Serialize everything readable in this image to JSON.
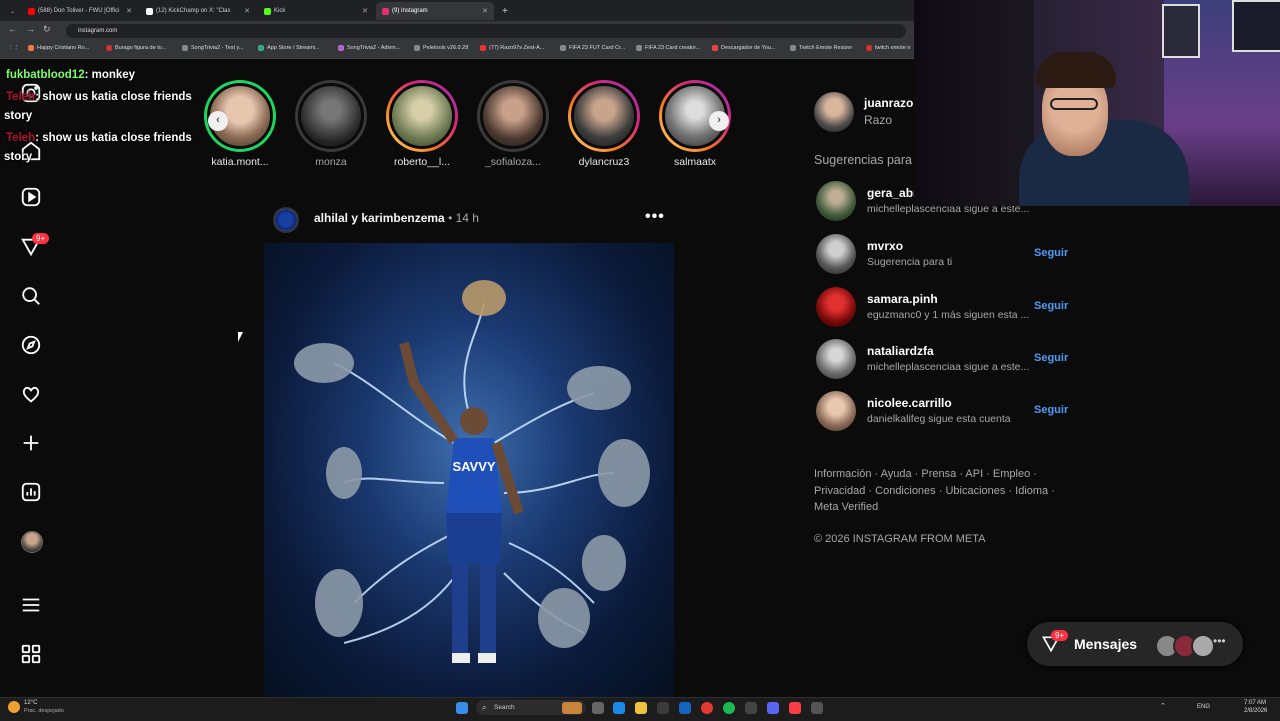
{
  "browser": {
    "tabs": [
      {
        "label": "(588) Don Toliver - FWU [Offici",
        "color": "#ff0000"
      },
      {
        "label": "(12) KickChamp on X: \"Clas",
        "color": "#ffffff"
      },
      {
        "label": "Kick",
        "color": "#53fc18"
      },
      {
        "label": "(9) Instagram",
        "color": "#e1306c"
      }
    ],
    "url": "instagram.com",
    "bookmarks": [
      "Happy Cristiano Ro...",
      "Burago figura de to...",
      "SongTrivia2 - Test y...",
      "App Store / Streami...",
      "SongTrivia2 - Adivin...",
      "Peletools v26.0.28",
      "(77) Razo97s Zest-A...",
      "FIFA 23 FUT Card Cr...",
      "FIFA 23 Card creator...",
      "Descargador de You...",
      "Twitch Emote Resizer",
      "twitch emote n"
    ]
  },
  "chat_overlay": {
    "line1_user": "fukbatblood12",
    "line1_msg": ": monkey",
    "line2_user": "Teleh",
    "line2_msg": ": show us katia close friends",
    "line2_cont": "story",
    "line3_user": "Teleh",
    "line3_msg": ": show us katia close friends",
    "line3_cont": "story"
  },
  "nav": {
    "notif_badge": "9+",
    "icons": [
      "instagram-icon",
      "home-icon",
      "reels-icon",
      "messages-icon",
      "search-icon",
      "explore-icon",
      "heart-icon",
      "create-icon",
      "dashboard-icon",
      "profile-icon",
      "menu-icon",
      "more-icon"
    ]
  },
  "stories": [
    {
      "name": "katia.mont...",
      "ring": "close-friends"
    },
    {
      "name": "monza",
      "ring": "seen"
    },
    {
      "name": "roberto__l...",
      "ring": "new"
    },
    {
      "name": "_sofialoza...",
      "ring": "seen"
    },
    {
      "name": "dylancruz3",
      "ring": "new"
    },
    {
      "name": "salmaatx",
      "ring": "new"
    }
  ],
  "post": {
    "author": "alhilal y karimbenzema",
    "sep": "•",
    "time": "14 h",
    "jersey_text": "SAVVY"
  },
  "profile": {
    "username": "juanrazo",
    "fullname": "Razo"
  },
  "suggestions": {
    "heading": "Sugerencias para ti",
    "follow_label": "Seguir",
    "items": [
      {
        "name": "gera_abr",
        "sub": "michelleplascenciaa sigue a este..."
      },
      {
        "name": "mvrxo",
        "sub": "Sugerencia para ti"
      },
      {
        "name": "samara.pinh",
        "sub": "eguzmanc0 y 1 más siguen esta ..."
      },
      {
        "name": "nataliardzfa",
        "sub": "michelleplascenciaa sigue a este..."
      },
      {
        "name": "nicolee.carrillo",
        "sub": "danielkalifeg sigue esta cuenta"
      }
    ]
  },
  "footer": {
    "line1": "Información · Ayuda · Prensa · API · Empleo ·",
    "line2": "Privacidad · Condiciones · Ubicaciones · Idioma ·",
    "line3": "Meta Verified",
    "copyright": "© 2026 INSTAGRAM FROM META"
  },
  "messages": {
    "label": "Mensajes",
    "badge": "9+"
  },
  "taskbar": {
    "weather_temp": "12°C",
    "weather_desc": "Prac. despejado",
    "search": "Search",
    "lang": "ENG",
    "time": "7:07 AM",
    "date": "2/8/2026"
  },
  "colors": {
    "accent": "#4f9cf5",
    "badge": "#ff3040",
    "background": "#0b0b0b"
  }
}
